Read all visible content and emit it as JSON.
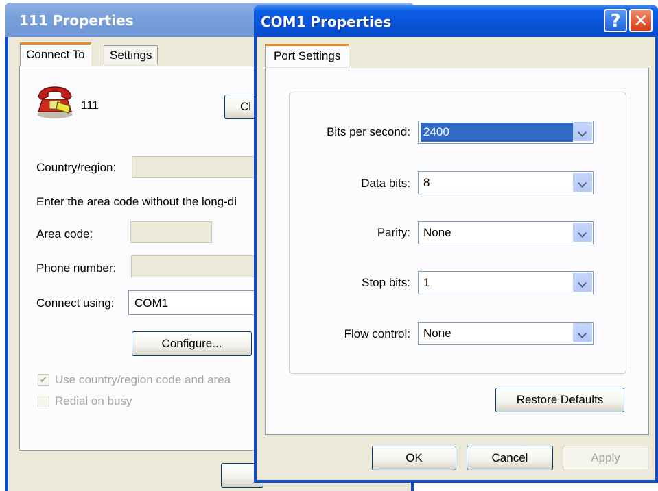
{
  "back_window": {
    "title": "111 Properties",
    "tabs": [
      {
        "label": "Connect To",
        "active": true
      },
      {
        "label": "Settings",
        "active": false
      }
    ],
    "connection_name": "111",
    "change_icon_button": "Cl",
    "country_label": "Country/region:",
    "instruction_text": "Enter the area code without the long-di",
    "area_code_label": "Area code:",
    "phone_number_label": "Phone number:",
    "connect_using_label": "Connect using:",
    "connect_using_value": "COM1",
    "configure_button": "Configure...",
    "use_country_checkbox": {
      "label": "Use country/region code and area",
      "checked": true
    },
    "redial_checkbox": {
      "label": "Redial on busy",
      "checked": false
    }
  },
  "front_window": {
    "title": "COM1 Properties",
    "help_button": "?",
    "close_button": "✕",
    "tab": "Port Settings",
    "fields": [
      {
        "label": "Bits per second:",
        "value": "2400"
      },
      {
        "label": "Data bits:",
        "value": "8"
      },
      {
        "label": "Parity:",
        "value": "None"
      },
      {
        "label": "Stop bits:",
        "value": "1"
      },
      {
        "label": "Flow control:",
        "value": "None"
      }
    ],
    "restore_defaults_button": "Restore Defaults",
    "ok_button": "OK",
    "cancel_button": "Cancel",
    "apply_button": "Apply"
  }
}
